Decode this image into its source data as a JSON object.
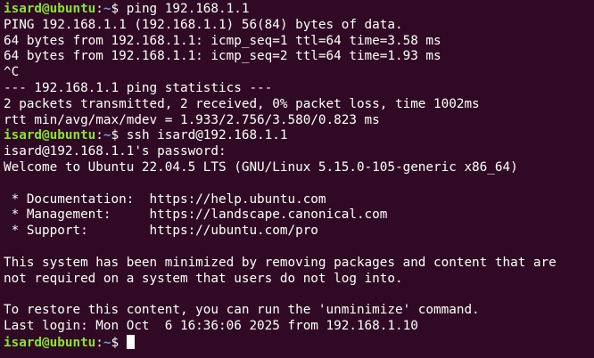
{
  "terminal": {
    "background": "#300a24",
    "prompt_user_color": "#8ae234",
    "prompt_path_color": "#729fcf",
    "lines": [
      {
        "type": "prompt",
        "user_host": "isard@ubuntu",
        "sep": ":",
        "path": "~",
        "symbol": "$ ",
        "command": "ping 192.168.1.1"
      },
      {
        "type": "text",
        "text": "PING 192.168.1.1 (192.168.1.1) 56(84) bytes of data."
      },
      {
        "type": "text",
        "text": "64 bytes from 192.168.1.1: icmp_seq=1 ttl=64 time=3.58 ms"
      },
      {
        "type": "text",
        "text": "64 bytes from 192.168.1.1: icmp_seq=2 ttl=64 time=1.93 ms"
      },
      {
        "type": "text",
        "text": "^C"
      },
      {
        "type": "text",
        "text": "--- 192.168.1.1 ping statistics ---"
      },
      {
        "type": "text",
        "text": "2 packets transmitted, 2 received, 0% packet loss, time 1002ms"
      },
      {
        "type": "text",
        "text": "rtt min/avg/max/mdev = 1.933/2.756/3.580/0.823 ms"
      },
      {
        "type": "prompt",
        "user_host": "isard@ubuntu",
        "sep": ":",
        "path": "~",
        "symbol": "$ ",
        "command": "ssh isard@192.168.1.1"
      },
      {
        "type": "text",
        "text": "isard@192.168.1.1's password:"
      },
      {
        "type": "text",
        "text": "Welcome to Ubuntu 22.04.5 LTS (GNU/Linux 5.15.0-105-generic x86_64)"
      },
      {
        "type": "text",
        "text": ""
      },
      {
        "type": "text",
        "text": " * Documentation:  https://help.ubuntu.com"
      },
      {
        "type": "text",
        "text": " * Management:     https://landscape.canonical.com"
      },
      {
        "type": "text",
        "text": " * Support:        https://ubuntu.com/pro"
      },
      {
        "type": "text",
        "text": ""
      },
      {
        "type": "text",
        "text": "This system has been minimized by removing packages and content that are"
      },
      {
        "type": "text",
        "text": "not required on a system that users do not log into."
      },
      {
        "type": "text",
        "text": ""
      },
      {
        "type": "text",
        "text": "To restore this content, you can run the 'unminimize' command."
      },
      {
        "type": "text",
        "text": "Last login: Mon Oct  6 16:36:06 2025 from 192.168.1.10"
      },
      {
        "type": "prompt",
        "user_host": "isard@ubuntu",
        "sep": ":",
        "path": "~",
        "symbol": "$ ",
        "command": "",
        "cursor": true
      }
    ]
  }
}
